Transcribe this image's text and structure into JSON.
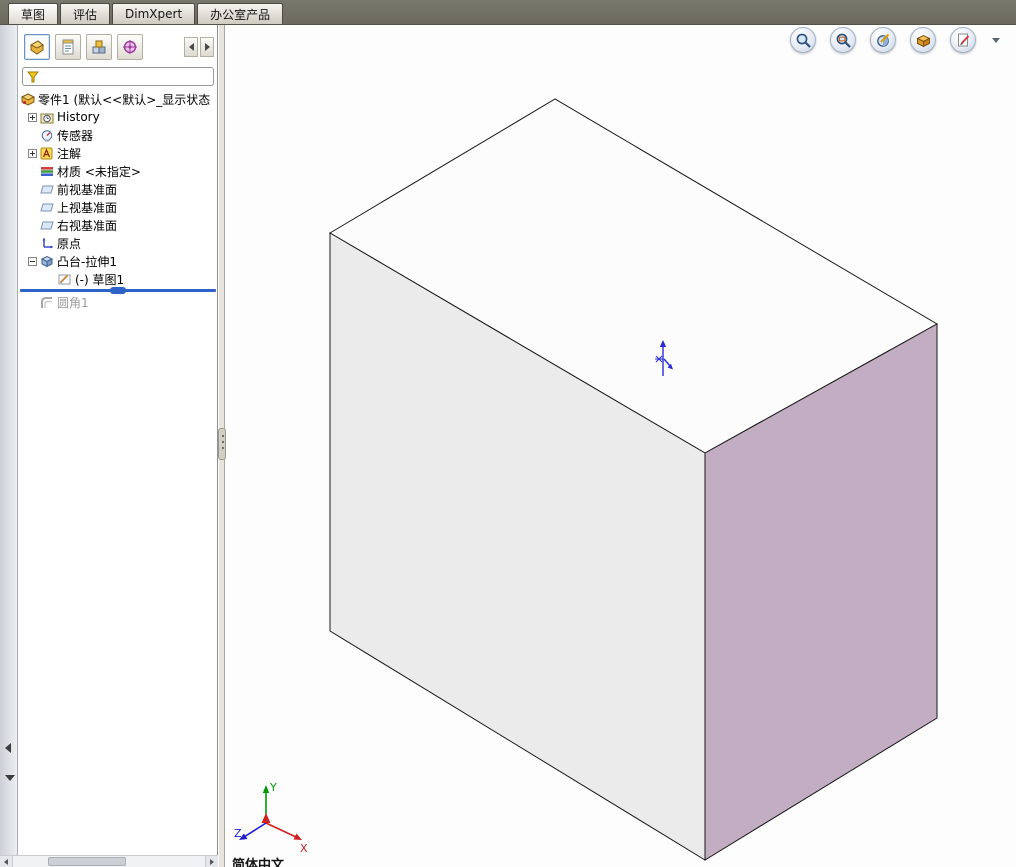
{
  "command_tabs": {
    "items": [
      {
        "label": "草图"
      },
      {
        "label": "评估"
      },
      {
        "label": "DimXpert"
      },
      {
        "label": "办公室产品"
      }
    ]
  },
  "panel_header": {
    "tabs": [
      {
        "name": "featuremanager-design-tree",
        "icon": "part-icon"
      },
      {
        "name": "propertymanager",
        "icon": "property-icon"
      },
      {
        "name": "configurationmanager",
        "icon": "configuration-icon"
      },
      {
        "name": "dimxpertmanager",
        "icon": "dimxpert-target-icon"
      }
    ]
  },
  "filter": {
    "value": "",
    "icon": "filter-funnel-icon"
  },
  "tree": {
    "items": [
      {
        "label": "零件1 (默认<<默认>_显示状态",
        "level": 0,
        "expand": "none",
        "icon": "part-icon"
      },
      {
        "label": "History",
        "level": 1,
        "expand": "plus",
        "icon": "history-icon"
      },
      {
        "label": "传感器",
        "level": 1,
        "expand": "none",
        "icon": "sensors-icon"
      },
      {
        "label": "注解",
        "level": 1,
        "expand": "plus",
        "icon": "annotations-icon"
      },
      {
        "label": "材质 <未指定>",
        "level": 1,
        "expand": "none",
        "icon": "material-icon"
      },
      {
        "label": "前视基准面",
        "level": 1,
        "expand": "none",
        "icon": "plane-icon"
      },
      {
        "label": "上视基准面",
        "level": 1,
        "expand": "none",
        "icon": "plane-icon"
      },
      {
        "label": "右视基准面",
        "level": 1,
        "expand": "none",
        "icon": "plane-icon"
      },
      {
        "label": "原点",
        "level": 1,
        "expand": "none",
        "icon": "origin-icon"
      },
      {
        "label": "凸台-拉伸1",
        "level": 1,
        "expand": "minus",
        "icon": "boss-extrude-icon"
      },
      {
        "label": "(-) 草图1",
        "level": 2,
        "expand": "none",
        "icon": "sketch-icon"
      },
      {
        "label": "圆角1",
        "level": 1,
        "expand": "none",
        "icon": "fillet-icon",
        "grayed": true
      }
    ]
  },
  "viewport": {
    "headsup_buttons": [
      {
        "name": "zoom-to-fit"
      },
      {
        "name": "zoom-to-area"
      },
      {
        "name": "section-view"
      },
      {
        "name": "apply-scene"
      },
      {
        "name": "view-settings"
      }
    ],
    "model": {
      "type": "rectangular-box-isometric",
      "face_colors": {
        "top": "#fcfcfd",
        "front": "#ebebec",
        "right": "#c3adc3"
      },
      "edge_color": "#1a1a1a"
    },
    "triad": {
      "x_label": "X",
      "y_label": "Y",
      "z_label": "Z"
    }
  },
  "status": {
    "text": "简体中文"
  }
}
